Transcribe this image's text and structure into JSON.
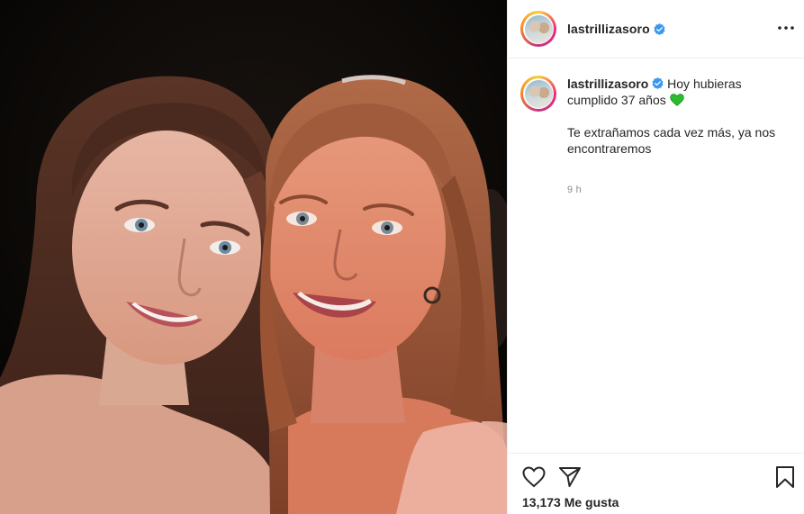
{
  "post": {
    "username": "lastrillizasoro",
    "caption": {
      "line1": "Hoy hubieras cumplido 37 años",
      "emoji": "green-heart",
      "paragraph2": "Te extrañamos cada vez más, ya nos encontraremos"
    },
    "timestamp": "9 h",
    "likes": "13,173 Me gusta"
  },
  "colors": {
    "verified": "#3897f0",
    "green_heart": "#2bbd2e",
    "text": "#262626",
    "muted": "#8e8e8e",
    "divider": "#efefef"
  },
  "icons": [
    "verified-badge-icon",
    "more-options-icon",
    "like-heart-icon",
    "share-paper-plane-icon",
    "save-bookmark-icon"
  ]
}
